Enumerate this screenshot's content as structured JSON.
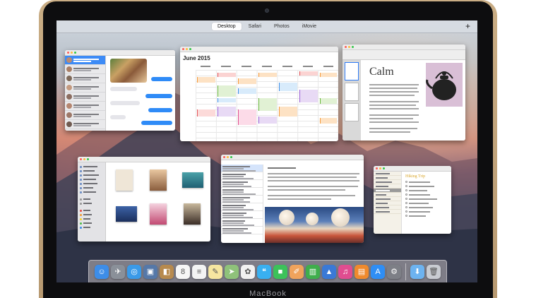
{
  "brand": "MacBook",
  "spaces_bar": {
    "tabs": [
      "Desktop",
      "Safari",
      "Photos",
      "iMovie"
    ],
    "active_tab": "Desktop",
    "add_label": "+"
  },
  "calendar": {
    "month_title": "June 2015"
  },
  "pages": {
    "doc_heading": "Calm"
  },
  "notes": {
    "title": "Hiking Trip"
  },
  "dock": {
    "apps": [
      {
        "name": "finder-icon",
        "color": "#3d8de8",
        "glyph": "☺"
      },
      {
        "name": "launchpad-icon",
        "color": "#8a9099",
        "glyph": "✈"
      },
      {
        "name": "safari-icon",
        "color": "#3a9ae8",
        "glyph": "◎"
      },
      {
        "name": "photo-booth-icon",
        "color": "#5578a8",
        "glyph": "▣"
      },
      {
        "name": "contacts-icon",
        "color": "#b78a4e",
        "glyph": "◧"
      },
      {
        "name": "calendar-icon",
        "color": "#f6f6f6",
        "glyph": "8"
      },
      {
        "name": "reminders-icon",
        "color": "#f3f3f3",
        "glyph": "≡"
      },
      {
        "name": "notes-icon",
        "color": "#f6e6a0",
        "glyph": "✎"
      },
      {
        "name": "maps-icon",
        "color": "#8fc27a",
        "glyph": "➤"
      },
      {
        "name": "photos-icon",
        "color": "#f1f1f1",
        "glyph": "✿"
      },
      {
        "name": "messages-icon",
        "color": "#39b0f0",
        "glyph": "❝"
      },
      {
        "name": "facetime-icon",
        "color": "#3cc25a",
        "glyph": "■"
      },
      {
        "name": "pages-icon",
        "color": "#f0a35c",
        "glyph": "✐"
      },
      {
        "name": "numbers-icon",
        "color": "#3fae4c",
        "glyph": "▥"
      },
      {
        "name": "keynote-icon",
        "color": "#3a79d6",
        "glyph": "▲"
      },
      {
        "name": "itunes-icon",
        "color": "#e04d90",
        "glyph": "♫"
      },
      {
        "name": "ibooks-icon",
        "color": "#f08a2d",
        "glyph": "▤"
      },
      {
        "name": "app-store-icon",
        "color": "#2f8ef5",
        "glyph": "A"
      },
      {
        "name": "system-preferences-icon",
        "color": "#7d7f86",
        "glyph": "⚙"
      }
    ],
    "trailing": [
      {
        "name": "downloads-folder-icon",
        "color": "#6db3f0",
        "glyph": "⬇"
      },
      {
        "name": "trash-icon",
        "color": "#c9ccd2",
        "glyph": "🗑"
      }
    ]
  }
}
